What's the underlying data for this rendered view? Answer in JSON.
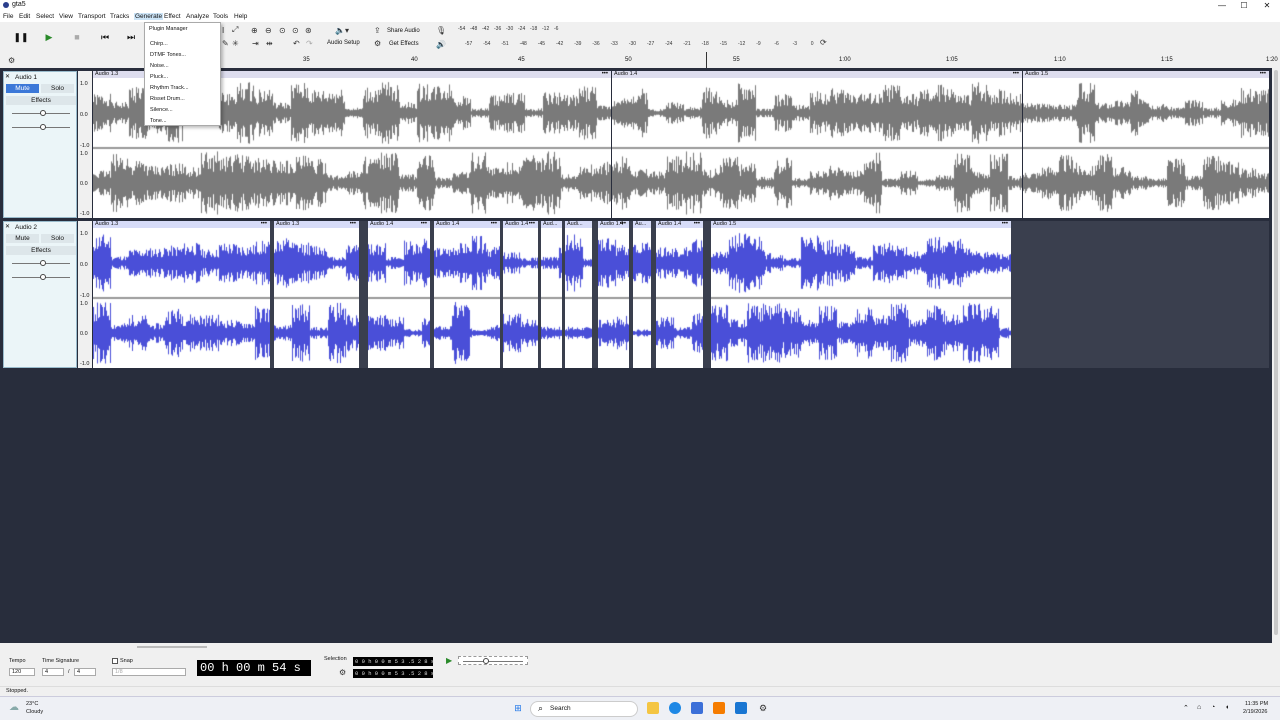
{
  "window": {
    "title": "gta5",
    "minimize": "—",
    "maximize": "☐",
    "close": "✕"
  },
  "menubar": [
    "File",
    "Edit",
    "Select",
    "View",
    "Transport",
    "Tracks",
    "Generate",
    "Effect",
    "Analyze",
    "Tools",
    "Help"
  ],
  "generate_menu": {
    "items": [
      "Plugin Manager",
      "Chirp...",
      "DTMF Tones...",
      "Noise...",
      "Pluck...",
      "Rhythm Track...",
      "Risset Drum...",
      "Silence...",
      "Tone..."
    ]
  },
  "toolbar": {
    "audio_setup": "Audio Setup",
    "share_audio": "Share Audio",
    "get_effects": "Get Effects",
    "meter_ticks_top": [
      "-54",
      "-48",
      "-42",
      "-36",
      "-30",
      "-24",
      "-18",
      "-12",
      "-6"
    ],
    "meter_ticks_bottom": [
      "-57",
      "-54",
      "-51",
      "-48",
      "-45",
      "-42",
      "-39",
      "-36",
      "-33",
      "-30",
      "-27",
      "-24",
      "-21",
      "-18",
      "-15",
      "-12",
      "-9",
      "-6",
      "-3",
      "0"
    ]
  },
  "ruler": {
    "ticks": [
      "35",
      "40",
      "45",
      "50",
      "55",
      "1:00",
      "1:05",
      "1:10",
      "1:15",
      "1:20"
    ]
  },
  "tracks": [
    {
      "name": "Audio 1",
      "mute": "Mute",
      "solo": "Solo",
      "effects": "Effects",
      "scale": [
        "1.0",
        "0.0",
        "-1.0",
        "1.0",
        "0.0",
        "-1.0"
      ],
      "clips": [
        {
          "name": "Audio 1.3",
          "menu": "•••"
        },
        {
          "name": "Audio 1.4",
          "menu": "•••"
        },
        {
          "name": "Audio 1.5",
          "menu": "•••"
        }
      ]
    },
    {
      "name": "Audio 2",
      "mute": "Mute",
      "solo": "Solo",
      "effects": "Effects",
      "scale": [
        "1.0",
        "0.0",
        "-1.0",
        "1.0",
        "0.0",
        "-1.0"
      ],
      "clips": [
        {
          "name": "Audio 1.3",
          "menu": "•••"
        },
        {
          "name": "Audio 1.3",
          "menu": "•••"
        },
        {
          "name": "Audio 1.4",
          "menu": "•••"
        },
        {
          "name": "Audio 1.4",
          "menu": "•••"
        },
        {
          "name": "Audio 1.4",
          "menu": "•••"
        },
        {
          "name": "Aud...",
          "menu": ""
        },
        {
          "name": "Audi...",
          "menu": ""
        },
        {
          "name": "Audio 1.4",
          "menu": "•••"
        },
        {
          "name": "Au...",
          "menu": ""
        },
        {
          "name": "Audio 1.4",
          "menu": "•••"
        },
        {
          "name": "Audio 1.5",
          "menu": "•••"
        }
      ]
    }
  ],
  "bottom": {
    "tempo_label": "Tempo",
    "tempo_value": "120",
    "timesig_label": "Time Signature",
    "timesig_num": "4",
    "timesig_sep": "/",
    "timesig_den": "4",
    "snap_label": "Snap",
    "snap_value": "1/8",
    "time_display": "00 h 00 m 54 s",
    "selection_label": "Selection",
    "selection_start": "0 0 h 0 0 m 5 3 .5 2 8 s",
    "selection_end": "0 0 h 0 0 m 5 3 .5 2 8 s"
  },
  "status": "Stopped.",
  "taskbar": {
    "weather_temp": "23°C",
    "weather_desc": "Cloudy",
    "search": "Search",
    "time": "11:35 PM",
    "date": "2/19/2026"
  },
  "colors": {
    "track_bg": "#282d3c",
    "wave_grey": "#7a7a7a",
    "wave_blue": "#4a4fd8",
    "panel": "#ebf5f8"
  }
}
